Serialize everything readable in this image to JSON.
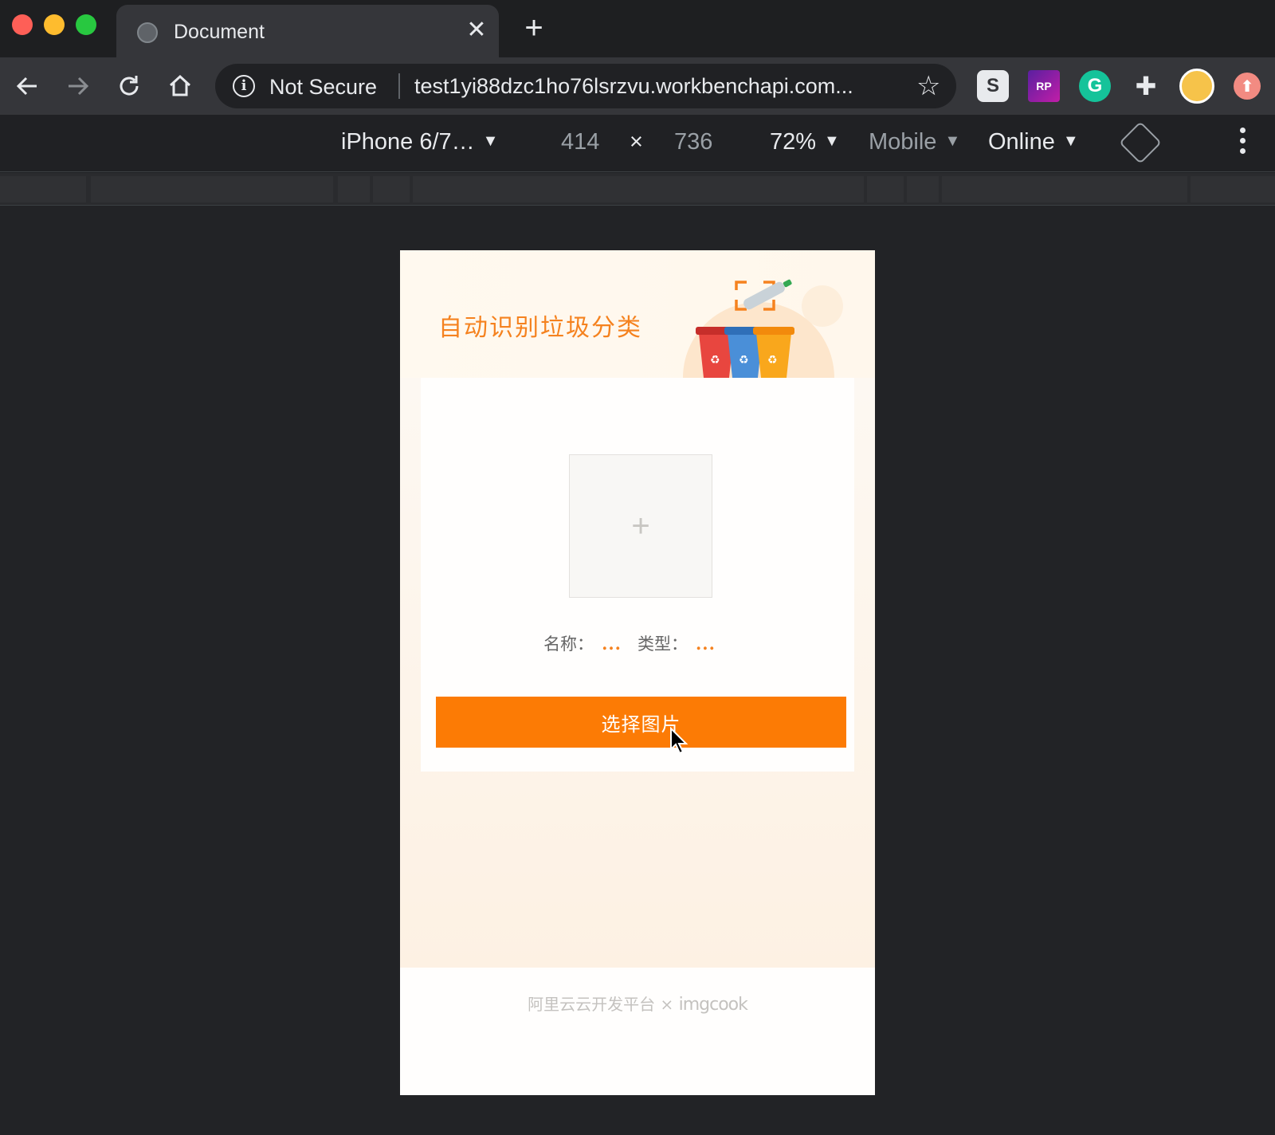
{
  "window": {
    "controls": [
      "close",
      "minimize",
      "maximize"
    ]
  },
  "tab": {
    "title": "Document",
    "favicon_icon": "globe-icon",
    "close_icon": "close-icon"
  },
  "newtab_icon": "plus-icon",
  "toolbar": {
    "back_icon": "arrow-left-icon",
    "forward_icon": "arrow-right-icon",
    "reload_icon": "reload-icon",
    "home_icon": "home-icon",
    "security_label": "Not Secure",
    "url": "test1yi88dzc1ho76lsrzvu.workbenchapi.com...",
    "bookmark_icon": "star-icon",
    "extensions": [
      {
        "name": "S",
        "icon": "s-extension-icon"
      },
      {
        "name": "RP",
        "icon": "rp-extension-icon"
      },
      {
        "name": "G",
        "icon": "grammarly-icon"
      },
      {
        "name": "extensions",
        "icon": "puzzle-icon"
      },
      {
        "name": "profile",
        "icon": "avatar-icon"
      },
      {
        "name": "update",
        "icon": "update-arrow-icon"
      }
    ]
  },
  "devtools": {
    "device": "iPhone 6/7…",
    "width": "414",
    "times": "×",
    "height": "736",
    "zoom": "72%",
    "mode": "Mobile",
    "network": "Online",
    "dropdown_arrow": "▼"
  },
  "app": {
    "title": "自动识别垃圾分类",
    "upload_placeholder": "+",
    "name_label": "名称：",
    "name_value": "...",
    "type_label": "类型：",
    "type_value": "...",
    "select_button": "选择图片",
    "footer_prefix": "阿里云云开发平台 × ",
    "footer_brand": "imgcook"
  },
  "colors": {
    "accent": "#fc7b05",
    "title": "#f5821f"
  }
}
